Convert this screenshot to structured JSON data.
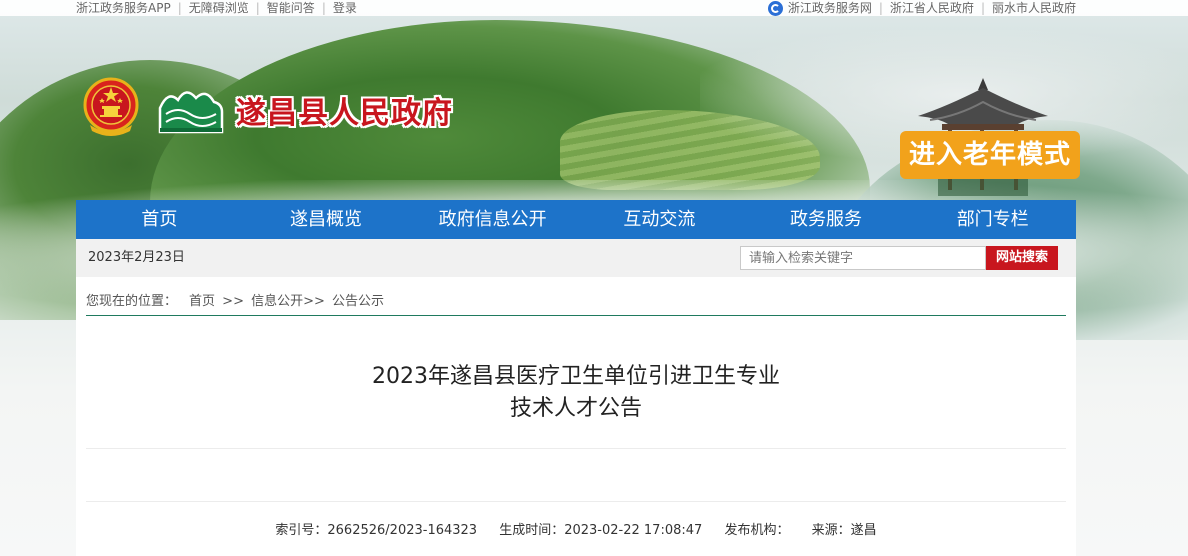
{
  "topbar": {
    "left_links": [
      "浙江政务服务APP",
      "无障碍浏览",
      "智能问答",
      "登录"
    ],
    "right_links": [
      "浙江政务服务网",
      "浙江省人民政府",
      "丽水市人民政府"
    ]
  },
  "header": {
    "site_title": "遂昌县人民政府",
    "elder_mode": "进入老年模式"
  },
  "nav": {
    "items": [
      "首页",
      "遂昌概览",
      "政府信息公开",
      "互动交流",
      "政务服务",
      "部门专栏"
    ]
  },
  "datebar": {
    "date": "2023年2月23日",
    "search_placeholder": "请输入检索关键字",
    "search_button": "网站搜索"
  },
  "breadcrumb": {
    "label": "您现在的位置：",
    "items": [
      "首页",
      ">>",
      "信息公开>>",
      "公告公示"
    ]
  },
  "article": {
    "title_line1": "2023年遂昌县医疗卫生单位引进卫生专业",
    "title_line2": "技术人才公告",
    "meta": {
      "index_no": "索引号：2662526/2023-164323",
      "created": "生成时间：2023-02-22 17:08:47",
      "publisher": "发布机构：",
      "source": "来源：遂昌"
    }
  },
  "colors": {
    "nav_blue": "#1d73c9",
    "title_red": "#c8161e",
    "elder_orange": "#f2a21b",
    "search_red": "#c8161e"
  }
}
